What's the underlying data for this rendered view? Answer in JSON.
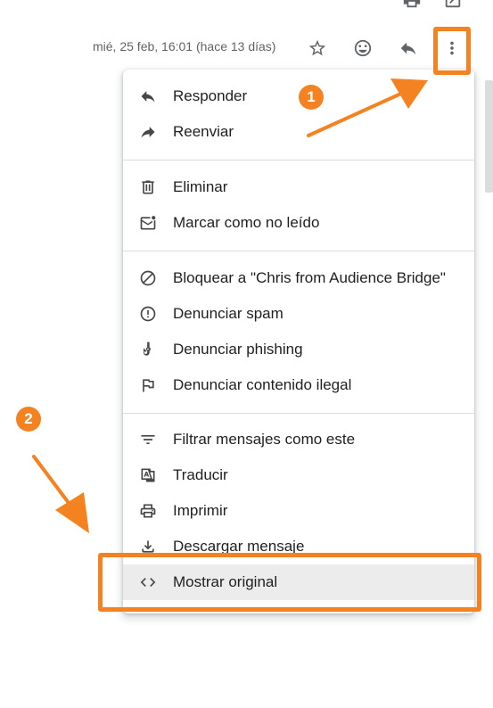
{
  "header": {
    "date": "mié, 25 feb, 16:01 (hace 13 días)",
    "icons": [
      "print-icon",
      "open-in-new-icon",
      "star-icon",
      "emoji-icon",
      "reply-icon",
      "more-vert-icon"
    ]
  },
  "menu": {
    "groups": [
      [
        {
          "icon": "reply-icon",
          "label": "Responder"
        },
        {
          "icon": "forward-icon",
          "label": "Reenviar"
        }
      ],
      [
        {
          "icon": "trash-icon",
          "label": "Eliminar"
        },
        {
          "icon": "mark-unread-icon",
          "label": "Marcar como no leído"
        }
      ],
      [
        {
          "icon": "block-icon",
          "label": "Bloquear a \"Chris from Audience Bridge\""
        },
        {
          "icon": "report-icon",
          "label": "Denunciar spam"
        },
        {
          "icon": "phishing-icon",
          "label": "Denunciar phishing"
        },
        {
          "icon": "flag-icon",
          "label": "Denunciar contenido ilegal"
        }
      ],
      [
        {
          "icon": "filter-icon",
          "label": "Filtrar mensajes como este"
        },
        {
          "icon": "translate-icon",
          "label": "Traducir"
        },
        {
          "icon": "print-icon",
          "label": "Imprimir"
        },
        {
          "icon": "download-icon",
          "label": "Descargar mensaje"
        },
        {
          "icon": "code-icon",
          "label": "Mostrar original",
          "highlighted": true
        }
      ]
    ]
  },
  "annotations": {
    "step1": "1",
    "step2": "2",
    "accent_color": "#f58220"
  }
}
